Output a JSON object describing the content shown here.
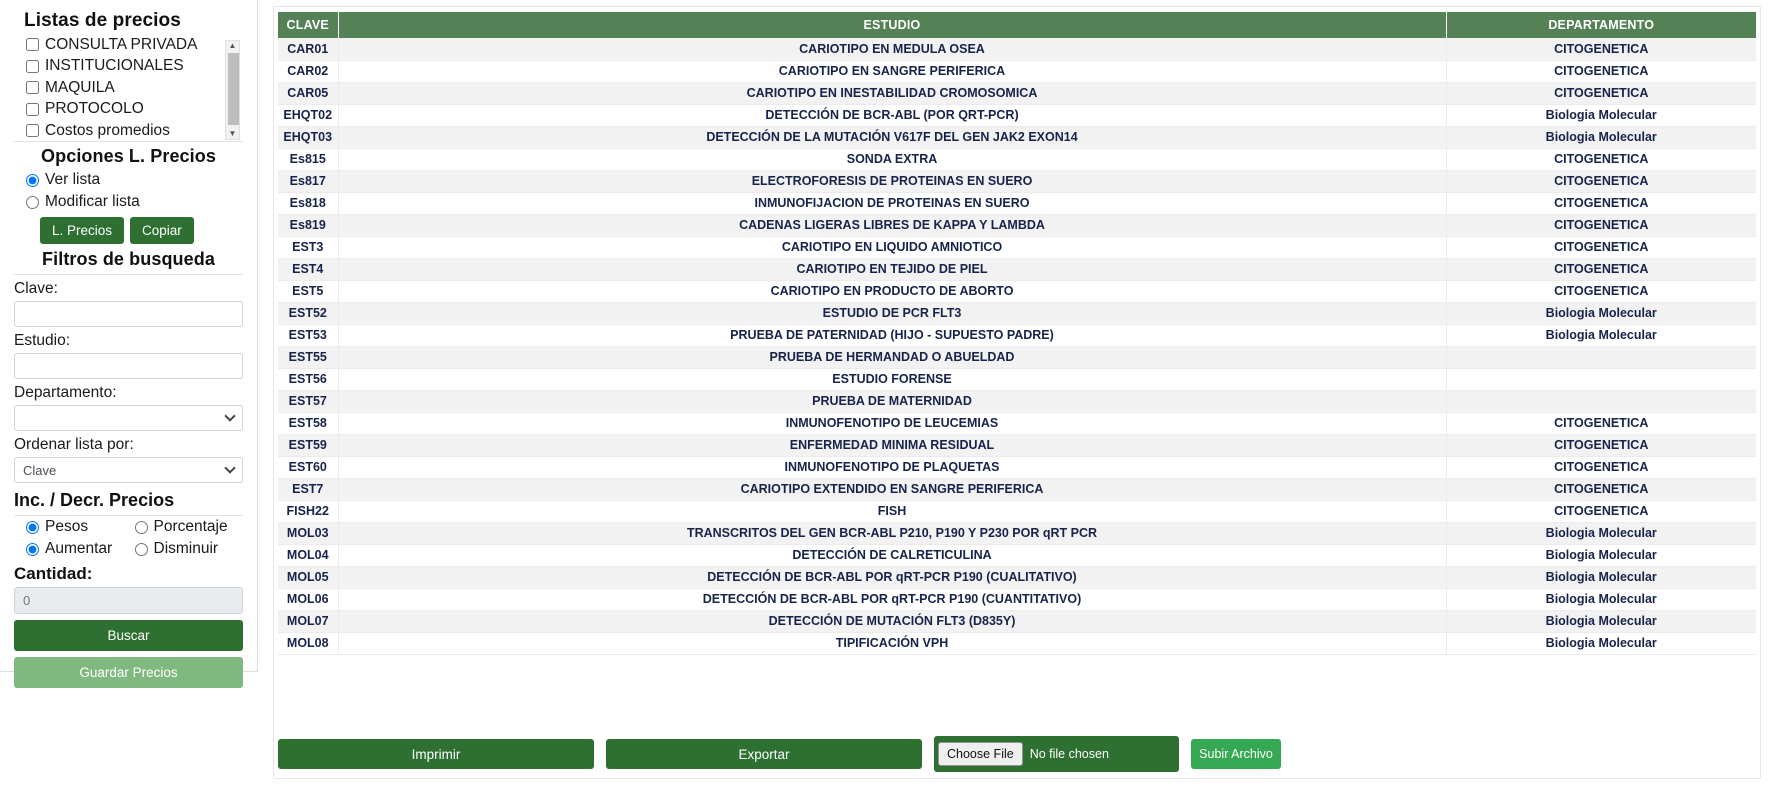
{
  "sidebar": {
    "price_lists": {
      "title": "Listas de precios",
      "items": [
        {
          "label": "CONSULTA PRIVADA",
          "checked": false
        },
        {
          "label": "INSTITUCIONALES",
          "checked": false
        },
        {
          "label": "MAQUILA",
          "checked": false
        },
        {
          "label": "PROTOCOLO",
          "checked": false
        },
        {
          "label": "Costos promedios",
          "checked": false
        }
      ]
    },
    "options": {
      "title": "Opciones L. Precios",
      "radios": [
        {
          "label": "Ver lista",
          "selected": true
        },
        {
          "label": "Modificar lista",
          "selected": false
        }
      ],
      "btn_precios": "L. Precios",
      "btn_copiar": "Copiar"
    },
    "filters": {
      "title": "Filtros de busqueda",
      "clave_label": "Clave:",
      "clave_value": "",
      "clave_placeholder": "",
      "estudio_label": "Estudio:",
      "estudio_value": "",
      "estudio_placeholder": "",
      "departamento_label": "Departamento:",
      "departamento_value": "",
      "orden_label": "Ordenar lista por:",
      "orden_value": "Clave"
    },
    "increment": {
      "title": "Inc. / Decr. Precios",
      "type_radios": [
        {
          "label": "Pesos",
          "selected": true
        },
        {
          "label": "Porcentaje",
          "selected": false
        }
      ],
      "dir_radios": [
        {
          "label": "Aumentar",
          "selected": true
        },
        {
          "label": "Disminuir",
          "selected": false
        }
      ],
      "cantidad_label": "Cantidad:",
      "cantidad_value": "",
      "cantidad_placeholder": "0"
    },
    "buscar_label": "Buscar",
    "guardar_label": "Guardar Precios"
  },
  "table": {
    "headers": [
      "CLAVE",
      "ESTUDIO",
      "DEPARTAMENTO"
    ],
    "rows": [
      [
        "CAR01",
        "CARIOTIPO EN MEDULA OSEA",
        "CITOGENETICA"
      ],
      [
        "CAR02",
        "CARIOTIPO EN SANGRE PERIFERICA",
        "CITOGENETICA"
      ],
      [
        "CAR05",
        "CARIOTIPO EN INESTABILIDAD CROMOSOMICA",
        "CITOGENETICA"
      ],
      [
        "EHQT02",
        "DETECCIÓN DE BCR-ABL (POR QRT-PCR)",
        "Biologia Molecular"
      ],
      [
        "EHQT03",
        "DETECCIÓN DE LA MUTACIÓN V617F DEL GEN JAK2 EXON14",
        "Biologia Molecular"
      ],
      [
        "Es815",
        "SONDA EXTRA",
        "CITOGENETICA"
      ],
      [
        "Es817",
        "ELECTROFORESIS DE PROTEINAS EN SUERO",
        "CITOGENETICA"
      ],
      [
        "Es818",
        "INMUNOFIJACION DE PROTEINAS EN SUERO",
        "CITOGENETICA"
      ],
      [
        "Es819",
        "CADENAS LIGERAS LIBRES DE KAPPA Y LAMBDA",
        "CITOGENETICA"
      ],
      [
        "EST3",
        "CARIOTIPO EN LIQUIDO AMNIOTICO",
        "CITOGENETICA"
      ],
      [
        "EST4",
        "CARIOTIPO EN TEJIDO DE PIEL",
        "CITOGENETICA"
      ],
      [
        "EST5",
        "CARIOTIPO EN PRODUCTO DE ABORTO",
        "CITOGENETICA"
      ],
      [
        "EST52",
        "ESTUDIO DE PCR FLT3",
        "Biologia Molecular"
      ],
      [
        "EST53",
        "PRUEBA DE PATERNIDAD (HIJO - SUPUESTO PADRE)",
        "Biologia Molecular"
      ],
      [
        "EST55",
        "PRUEBA DE HERMANDAD O ABUELDAD",
        ""
      ],
      [
        "EST56",
        "ESTUDIO FORENSE",
        ""
      ],
      [
        "EST57",
        "PRUEBA DE MATERNIDAD",
        ""
      ],
      [
        "EST58",
        "INMUNOFENOTIPO DE LEUCEMIAS",
        "CITOGENETICA"
      ],
      [
        "EST59",
        "ENFERMEDAD MINIMA RESIDUAL",
        "CITOGENETICA"
      ],
      [
        "EST60",
        "INMUNOFENOTIPO DE PLAQUETAS",
        "CITOGENETICA"
      ],
      [
        "EST7",
        "CARIOTIPO EXTENDIDO EN SANGRE PERIFERICA",
        "CITOGENETICA"
      ],
      [
        "FISH22",
        "FISH",
        "CITOGENETICA"
      ],
      [
        "MOL03",
        "TRANSCRITOS DEL GEN BCR-ABL P210, P190 Y P230 POR qRT PCR",
        "Biologia Molecular"
      ],
      [
        "MOL04",
        "DETECCIÓN DE CALRETICULINA",
        "Biologia Molecular"
      ],
      [
        "MOL05",
        "DETECCIÓN DE BCR-ABL POR qRT-PCR P190 (CUALITATIVO)",
        "Biologia Molecular"
      ],
      [
        "MOL06",
        "DETECCIÓN DE BCR-ABL POR qRT-PCR P190 (CUANTITATIVO)",
        "Biologia Molecular"
      ],
      [
        "MOL07",
        "DETECCIÓN DE MUTACIÓN FLT3 (D835Y)",
        "Biologia Molecular"
      ],
      [
        "MOL08",
        "TIPIFICACIÓN VPH",
        "Biologia Molecular"
      ]
    ]
  },
  "bottom": {
    "imprimir": "Imprimir",
    "exportar": "Exportar",
    "choose_file": "Choose File",
    "no_file": "No file chosen",
    "subir": "Subir Archivo"
  },
  "colors": {
    "green_dark": "#2e7031",
    "green_header": "#558157",
    "green_light": "#7fb980",
    "green_bright": "#34a853",
    "text_navy": "#17234a"
  }
}
